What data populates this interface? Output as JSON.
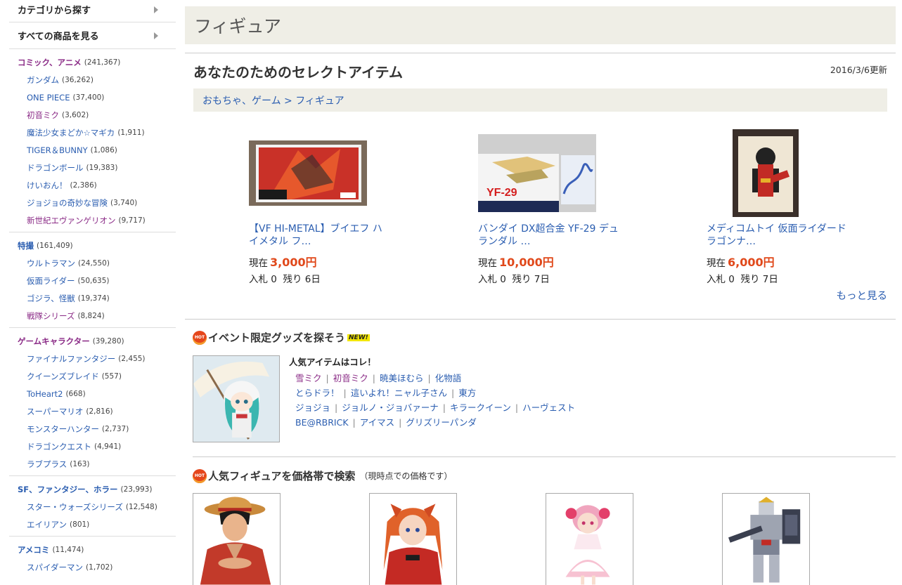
{
  "sidebar": {
    "top_links": [
      {
        "label": "カテゴリから探す"
      },
      {
        "label": "すべての商品を見る"
      }
    ],
    "groups": [
      {
        "label": "コミック、アニメ",
        "count": "(241,367)",
        "items": [
          {
            "label": "ガンダム",
            "count": "(36,262)"
          },
          {
            "label": "ONE PIECE",
            "count": "(37,400)"
          },
          {
            "label": "初音ミク",
            "count": "(3,602)"
          },
          {
            "label": "魔法少女まどか☆マギカ",
            "count": "(1,911)"
          },
          {
            "label": "TIGER＆BUNNY",
            "count": "(1,086)"
          },
          {
            "label": "ドラゴンボール",
            "count": "(19,383)"
          },
          {
            "label": "けいおん！",
            "count": "(2,386)"
          },
          {
            "label": "ジョジョの奇妙な冒険",
            "count": "(3,740)"
          },
          {
            "label": "新世紀エヴァンゲリオン",
            "count": "(9,717)"
          }
        ]
      },
      {
        "label": "特撮",
        "count": "(161,409)",
        "items": [
          {
            "label": "ウルトラマン",
            "count": "(24,550)"
          },
          {
            "label": "仮面ライダー",
            "count": "(50,635)"
          },
          {
            "label": "ゴジラ、怪獣",
            "count": "(19,374)"
          },
          {
            "label": "戦隊シリーズ",
            "count": "(8,824)"
          }
        ]
      },
      {
        "label": "ゲームキャラクター",
        "count": "(39,280)",
        "items": [
          {
            "label": "ファイナルファンタジー",
            "count": "(2,455)"
          },
          {
            "label": "クイーンズブレイド",
            "count": "(557)"
          },
          {
            "label": "ToHeart2",
            "count": "(668)"
          },
          {
            "label": "スーパーマリオ",
            "count": "(2,816)"
          },
          {
            "label": "モンスターハンター",
            "count": "(2,737)"
          },
          {
            "label": "ドラゴンクエスト",
            "count": "(4,941)"
          },
          {
            "label": "ラブプラス",
            "count": "(163)"
          }
        ]
      },
      {
        "label": "SF、ファンタジー、ホラー",
        "count": "(23,993)",
        "items": [
          {
            "label": "スター・ウォーズシリーズ",
            "count": "(12,548)"
          },
          {
            "label": "エイリアン",
            "count": "(801)"
          }
        ]
      },
      {
        "label": "アメコミ",
        "count": "(11,474)",
        "items": [
          {
            "label": "スパイダーマン",
            "count": "(1,702)"
          }
        ]
      }
    ]
  },
  "main": {
    "page_title": "フィギュア",
    "select_title": "あなたのためのセレクトアイテム",
    "updated": "2016/3/6更新",
    "breadcrumb": "おもちゃ、ゲーム > フィギュア",
    "products": [
      {
        "name": "【VF HI-METAL】ブイエフ ハイメタル フ…",
        "price_label": "現在",
        "price": "3,000円",
        "bids": "入札 0",
        "remaining": "残り 6日"
      },
      {
        "name": "バンダイ DX超合金 YF-29 デュランダル …",
        "price_label": "現在",
        "price": "10,000円",
        "bids": "入札 0",
        "remaining": "残り 7日"
      },
      {
        "name": "メディコムトイ 仮面ライダードラゴンナ…",
        "price_label": "現在",
        "price": "6,000円",
        "bids": "入札 0",
        "remaining": "残り 7日"
      }
    ],
    "more_link": "もっと見る",
    "event": {
      "heading": "イベント限定グッズを探そう",
      "new_badge": "NEW!",
      "hot_badge": "HOT",
      "popular_title": "人気アイテムはコレ！",
      "tag_rows": [
        [
          {
            "label": "雪ミク",
            "color": "purple"
          },
          {
            "label": "初音ミク",
            "color": "purple"
          },
          {
            "label": "暁美ほむら",
            "color": "blue"
          },
          {
            "label": "化物語",
            "color": "blue"
          }
        ],
        [
          {
            "label": "とらドラ！",
            "color": "blue"
          },
          {
            "label": "這いよれ！ニャル子さん",
            "color": "blue"
          },
          {
            "label": "東方",
            "color": "blue"
          }
        ],
        [
          {
            "label": "ジョジョ",
            "color": "blue"
          },
          {
            "label": "ジョルノ・ジョバァーナ",
            "color": "blue"
          },
          {
            "label": "キラークイーン",
            "color": "blue"
          },
          {
            "label": "ハーヴェスト",
            "color": "blue"
          }
        ],
        [
          {
            "label": "BE@RBRICK",
            "color": "blue"
          },
          {
            "label": "アイマス",
            "color": "blue"
          },
          {
            "label": "グリズリーパンダ",
            "color": "blue"
          }
        ]
      ]
    },
    "price_search": {
      "heading": "人気フィギュアを価格帯で検索",
      "note": "（現時点での価格です）",
      "hot_badge": "HOT"
    }
  },
  "colors": {
    "accent_purple": "#8a2a86",
    "link_blue": "#2a5db0",
    "price_red": "#e0481a",
    "band_beige": "#efeee6"
  }
}
